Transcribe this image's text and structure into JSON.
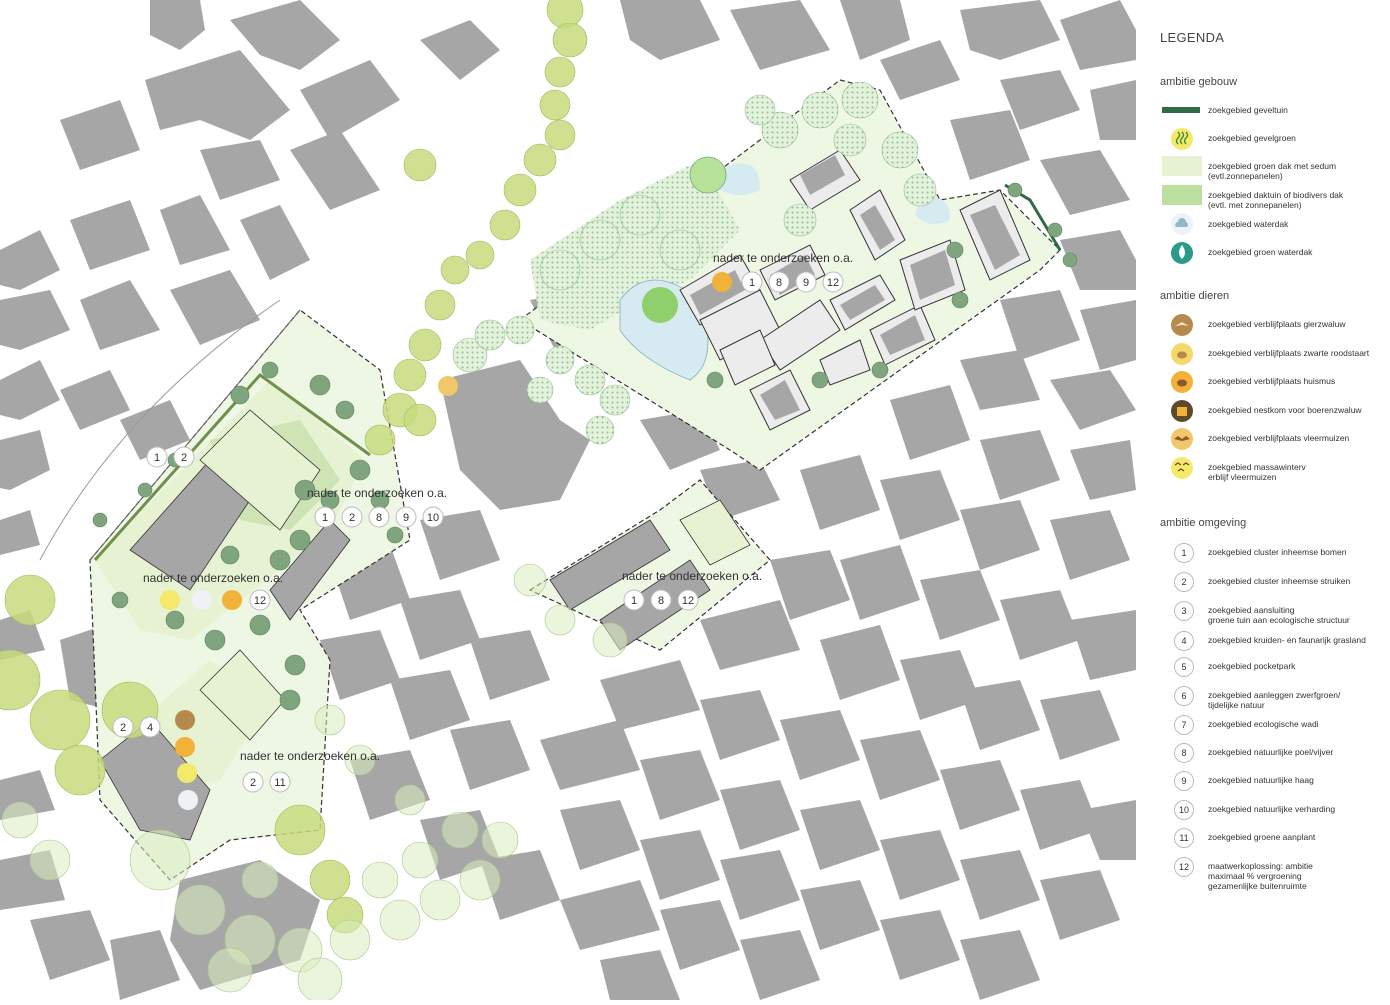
{
  "map": {
    "study_labels": [
      {
        "text": "nader te onderzoeken o.a.",
        "numbers": [
          "1",
          "8",
          "9",
          "12"
        ]
      },
      {
        "text": "nader te onderzoeken o.a.",
        "numbers": [
          "1",
          "2",
          "8",
          "9",
          "10"
        ]
      },
      {
        "text": "nader te onderzoeken o.a.",
        "numbers": [
          "12"
        ]
      },
      {
        "text": "nader te onderzoeken o.a.",
        "numbers": [
          "1",
          "8",
          "12"
        ]
      },
      {
        "text": "nader te onderzoeken o.a.",
        "numbers": [
          "2",
          "11"
        ]
      }
    ],
    "loose_numbers": [
      [
        "1",
        "2"
      ],
      [
        "2",
        "4"
      ]
    ],
    "colors": {
      "building": "#a6a6a6",
      "tree_light": "#d9ecbe",
      "tree_lime": "#c7dc7e",
      "tree_dark": "#7ea57e",
      "roof_light": "#e6f2d2",
      "roof_green": "#bde0a0",
      "water": "#d6eaf2",
      "facade_garden": "#2f6b46"
    }
  },
  "legend": {
    "title": "LEGENDA",
    "sections": [
      {
        "heading": "ambitie gebouw",
        "items": [
          {
            "symbol": "dark-green-bar-icon",
            "label": "zoekgebied geveltuin"
          },
          {
            "symbol": "facade-green-icon",
            "label": "zoekgebied gevelgroen"
          },
          {
            "symbol": "light-green-swatch-icon",
            "label": "zoekgebied groen dak met sedum\n(evtl.zonnepanelen)"
          },
          {
            "symbol": "green-swatch-icon",
            "label": "zoekgebied daktuin of biodivers dak\n(evtl. met zonnepanelen)"
          },
          {
            "symbol": "cloud-icon",
            "label": "zoekgebied waterdak"
          },
          {
            "symbol": "water-drop-icon",
            "label": "zoekgebied groen waterdak"
          }
        ]
      },
      {
        "heading": "ambitie dieren",
        "items": [
          {
            "symbol": "swift-icon",
            "label": "zoekgebied verblijfplaats gierzwaluw"
          },
          {
            "symbol": "redstart-icon",
            "label": "zoekgebied verblijfplaats zwarte roodstaart"
          },
          {
            "symbol": "sparrow-icon",
            "label": "zoekgebied verblijfplaats huismus"
          },
          {
            "symbol": "nestbox-icon",
            "label": "zoekgebied nestkom voor boerenzwaluw"
          },
          {
            "symbol": "bat-icon",
            "label": "zoekgebied verblijfplaats vleermuizen"
          },
          {
            "symbol": "bats-group-icon",
            "label": "zoekgebied massawinterv\nerblijf vleermuizen"
          }
        ]
      },
      {
        "heading": "ambitie omgeving",
        "items": [
          {
            "num": "1",
            "label": "zoekgebied cluster inheemse bomen"
          },
          {
            "num": "2",
            "label": "zoekgebied cluster inheemse struiken"
          },
          {
            "num": "3",
            "label": "zoekgebied aansluiting\ngroene tuin aan ecologische structuur"
          },
          {
            "num": "4",
            "label": "zoekgebied kruiden- en faunarijk grasland"
          },
          {
            "num": "5",
            "label": "zoekgebied pocketpark"
          },
          {
            "num": "6",
            "label": "zoekgebied aanleggen zwerfgroen/\ntijdelijke natuur"
          },
          {
            "num": "7",
            "label": "zoekgebied ecologische wadi"
          },
          {
            "num": "8",
            "label": "zoekgebied natuurlijke poel/vijver"
          },
          {
            "num": "9",
            "label": "zoekgebied natuurlijke haag"
          },
          {
            "num": "10",
            "label": "zoekgebied natuurlijke verharding"
          },
          {
            "num": "11",
            "label": "zoekgebied groene aanplant"
          },
          {
            "num": "12",
            "label": "maatwerkoplossing: ambitie\nmaximaal % vergroening\ngezamenlijke buitenruimte"
          }
        ]
      }
    ]
  }
}
